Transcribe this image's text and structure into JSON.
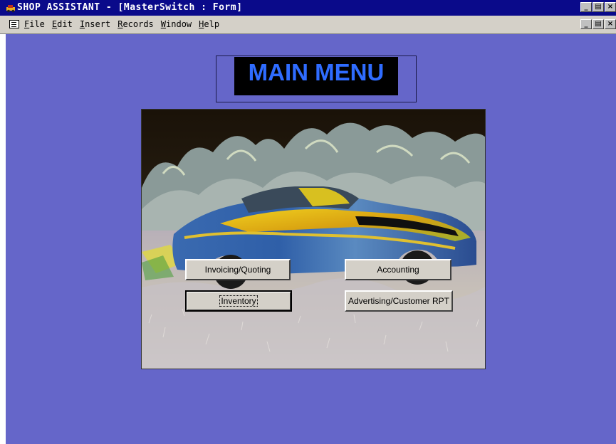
{
  "window": {
    "title": "SHOP ASSISTANT - [MasterSwitch : Form]",
    "app_icon": "car-app-icon",
    "controls": [
      "_",
      "\u0001",
      "x"
    ]
  },
  "menubar": {
    "items": [
      "File",
      "Edit",
      "Insert",
      "Records",
      "Window",
      "Help"
    ],
    "doc_icon": "form-document-icon"
  },
  "form": {
    "header": "MAIN MENU",
    "background_color": "#6566c9",
    "photo": "car-in-field-photo",
    "buttons": {
      "invoicing": "Invoicing/Quoting",
      "accounting": "Accounting",
      "inventory": "Inventory",
      "advertising": "Advertising/Customer RPT"
    }
  }
}
